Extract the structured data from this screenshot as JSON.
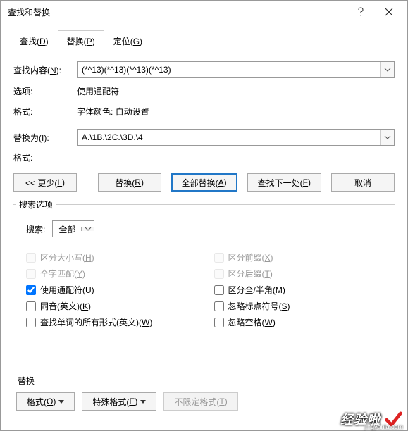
{
  "title": "查找和替换",
  "tabs": {
    "find": {
      "label": "查找(",
      "key": "D",
      "suffix": ")"
    },
    "replace": {
      "label": "替换(",
      "key": "P",
      "suffix": ")"
    },
    "goto": {
      "label": "定位(",
      "key": "G",
      "suffix": ")"
    }
  },
  "labels": {
    "find_what": "查找内容(",
    "find_what_key": "N",
    "find_what_suffix": "):",
    "options": "选项:",
    "format_lbl": "格式:",
    "replace_with": "替换为(",
    "replace_with_key": "I",
    "replace_with_suffix": "):",
    "format_lbl2": "格式:"
  },
  "values": {
    "find_what": "(*^13)(*^13)(*^13)(*^13)",
    "options": "使用通配符",
    "format": "字体颜色: 自动设置",
    "replace_with": "A.\\1B.\\2C.\\3D.\\4",
    "format2": ""
  },
  "buttons": {
    "less": "<< 更少(",
    "less_key": "L",
    "less_suffix": ")",
    "replace": "替换(",
    "replace_key": "R",
    "replace_suffix": ")",
    "replace_all": "全部替换(",
    "replace_all_key": "A",
    "replace_all_suffix": ")",
    "find_next": "查找下一处(",
    "find_next_key": "F",
    "find_next_suffix": ")",
    "cancel": "取消"
  },
  "search_options_legend": "搜索选项",
  "search": {
    "label": "搜索:",
    "value": "全部"
  },
  "checks": {
    "match_case": {
      "label": "区分大小写(",
      "key": "H",
      "suffix": ")",
      "checked": false,
      "disabled": true
    },
    "whole_word": {
      "label": "全字匹配(",
      "key": "Y",
      "suffix": ")",
      "checked": false,
      "disabled": true
    },
    "use_wildcards": {
      "label": "使用通配符(",
      "key": "U",
      "suffix": ")",
      "checked": true,
      "disabled": false
    },
    "sounds_like": {
      "label": "同音(英文)(",
      "key": "K",
      "suffix": ")",
      "checked": false,
      "disabled": false
    },
    "all_word_forms": {
      "label": "查找单词的所有形式(英文)(",
      "key": "W",
      "suffix": ")",
      "checked": false,
      "disabled": false
    },
    "match_prefix": {
      "label": "区分前缀(",
      "key": "X",
      "suffix": ")",
      "checked": false,
      "disabled": true
    },
    "match_suffix": {
      "label": "区分后缀(",
      "key": "T",
      "suffix": ")",
      "checked": false,
      "disabled": true
    },
    "full_half": {
      "label": "区分全/半角(",
      "key": "M",
      "suffix": ")",
      "checked": false,
      "disabled": false
    },
    "ignore_punct": {
      "label": "忽略标点符号(",
      "key": "S",
      "suffix": ")",
      "checked": false,
      "disabled": false
    },
    "ignore_space": {
      "label": "忽略空格(",
      "key": "W",
      "suffix": ")",
      "checked": false,
      "disabled": false
    }
  },
  "replace_section_label": "替换",
  "format_buttons": {
    "format": {
      "label": "格式(",
      "key": "O",
      "suffix": ")"
    },
    "special": {
      "label": "特殊格式(",
      "key": "E",
      "suffix": ")"
    },
    "no_format": {
      "label": "不限定格式(",
      "key": "T",
      "suffix": ")"
    }
  },
  "watermark": {
    "text": "经验啦",
    "url": "jingyanla.com"
  }
}
